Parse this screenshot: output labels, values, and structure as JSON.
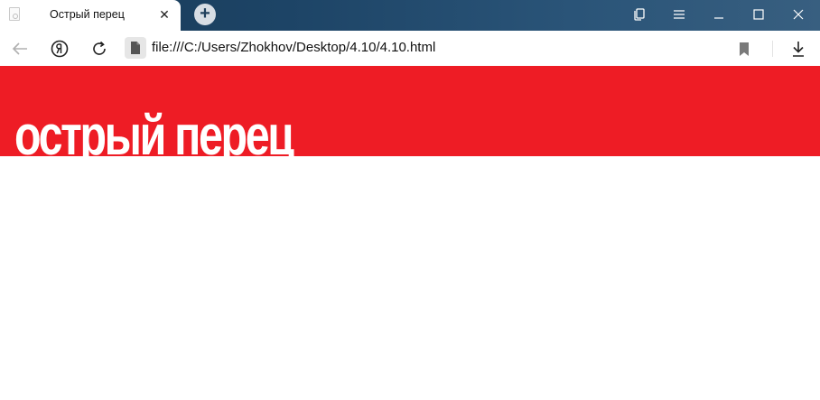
{
  "browser": {
    "tab": {
      "title": "Острый перец",
      "close_label": "✕"
    },
    "new_tab_label": "+",
    "address": {
      "url": "file:///C:/Users/Zhokhov/Desktop/4.10/4.10.html"
    }
  },
  "page": {
    "heading": "острый перец",
    "header_color": "#ee1c25",
    "heading_color": "#ffffff"
  },
  "icons": {
    "tab_favicon": "page-icon",
    "back": "arrow-left-icon",
    "yandex": "yandex-logo-icon",
    "reload": "reload-icon",
    "file": "file-icon",
    "bookmark": "bookmark-icon",
    "download": "download-icon",
    "collections": "collections-icon",
    "menu": "menu-icon",
    "minimize": "minimize-icon",
    "maximize": "maximize-icon",
    "close": "close-icon"
  }
}
